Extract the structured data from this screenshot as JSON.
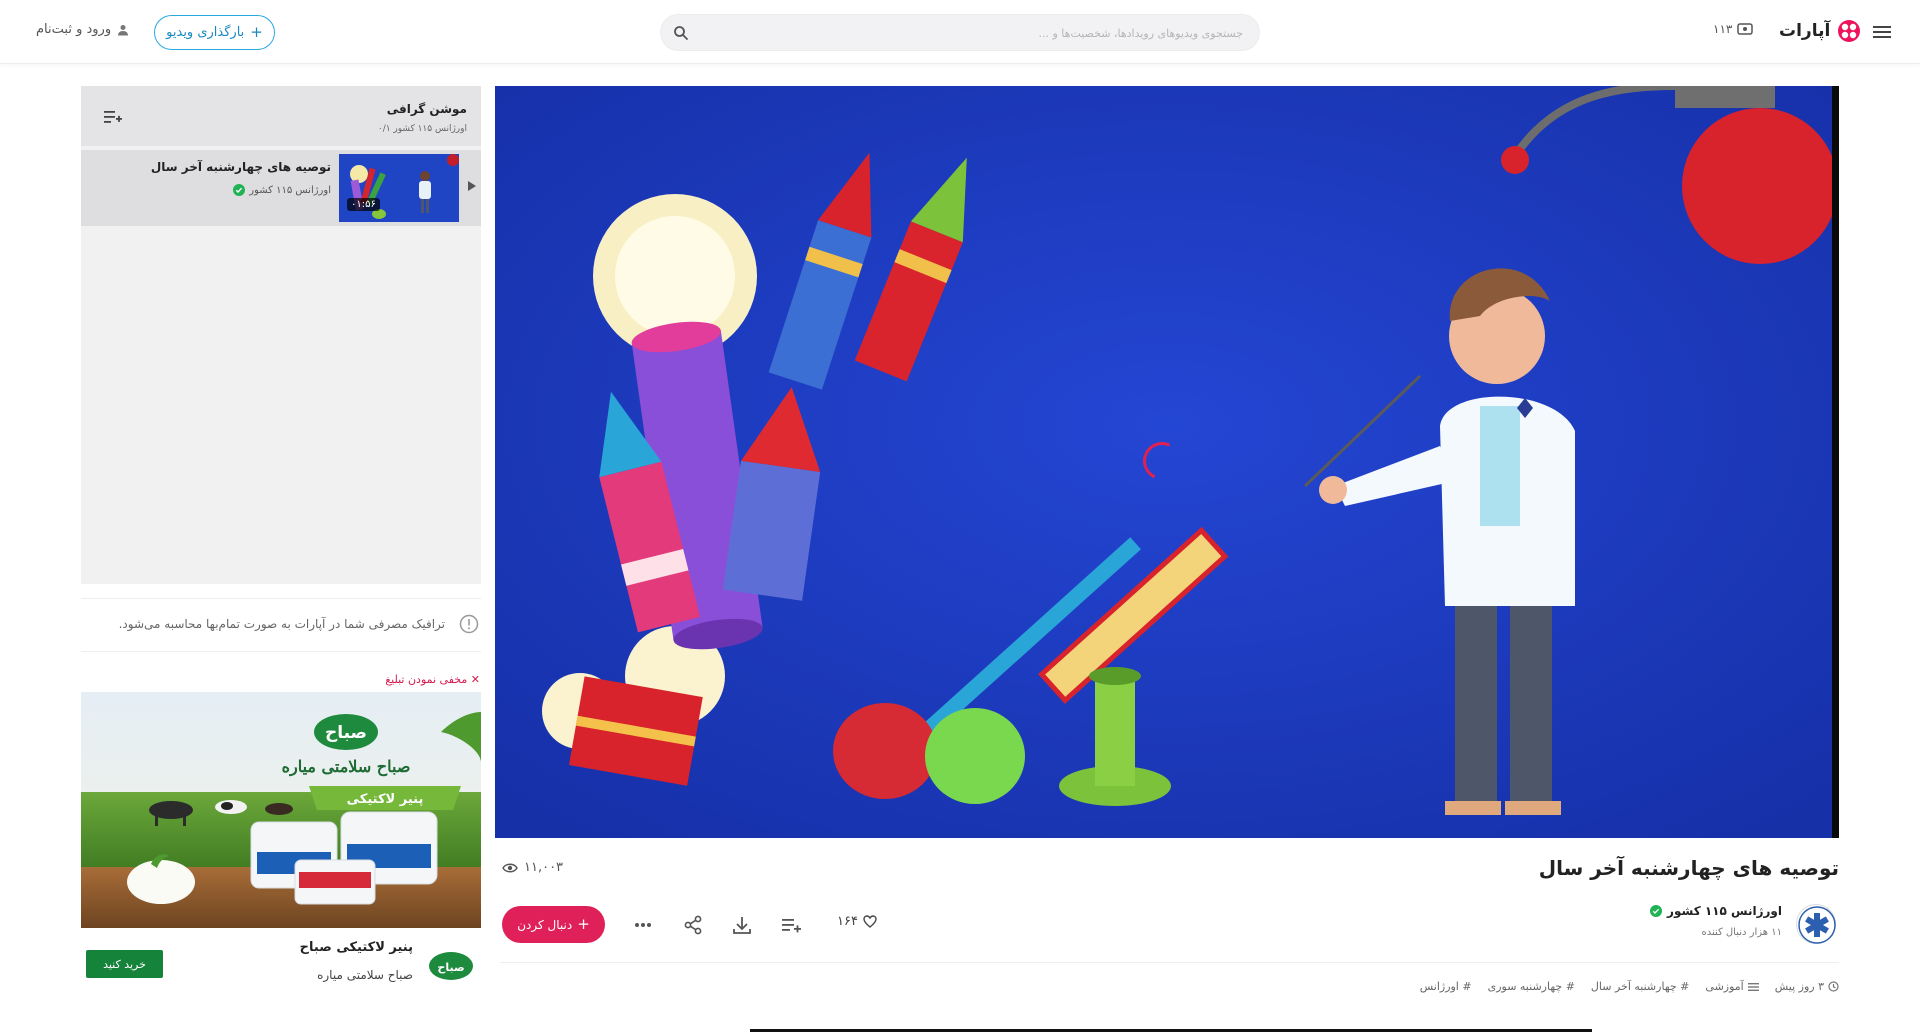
{
  "header": {
    "login_label": "ورود و ثبت‌نام",
    "upload_label": "بارگذاری ویدیو",
    "search_placeholder": "جستجوی ویدیوهای رویدادها، شخصیت‌ها و ...",
    "counter": "۱۱۳",
    "logo_text": "آپارات",
    "icons": [
      "user-icon",
      "plus-icon",
      "search-icon",
      "live-icon",
      "aparat-logo-icon",
      "hamburger-menu-icon"
    ]
  },
  "playlist": {
    "title": "موشن گرافی",
    "meta": "اورژانس ۱۱۵ کشور ۰/۱",
    "items": [
      {
        "title": "توصیه های چهارشنبه آخر سال",
        "channel": "اورژانس ۱۱۵ کشور",
        "duration": "۰۱:۵۶"
      }
    ]
  },
  "traffic_notice": "ترافیک مصرفی شما در آپارات به صورت تمام‌بها محاسبه می‌شود.",
  "ad": {
    "hide_label": "✕ مخفی نمودن تبلیغ",
    "banner_brand": "صباح",
    "banner_slogan": "صباح سلامتی میاره",
    "banner_product": "پنیر لاکتیکی",
    "title": "پنیر لاکتیکی صباح",
    "subtitle": "صباح سلامتی میاره",
    "logo_text": "صباح",
    "buy_label": "خرید کنید"
  },
  "video": {
    "title": "توصیه های چهارشنبه آخر سال",
    "views": "۱۱,۰۰۳",
    "channel_name": "اورژانس ۱۱۵ کشور",
    "channel_followers": "۱۱ هزار دنبال کننده",
    "follow_label": "دنبال کردن",
    "likes": "۱۶۴",
    "time_ago": "۳ روز پیش",
    "category": "آموزشی",
    "tags": [
      "# چهارشنبه آخر سال",
      "# چهارشنبه سوری",
      "# اورژانس"
    ]
  },
  "colors": {
    "accent": "#e02159",
    "upload_border": "#2aa9e0",
    "player_bg": "#1a33b8",
    "buy_green": "#16833a"
  }
}
